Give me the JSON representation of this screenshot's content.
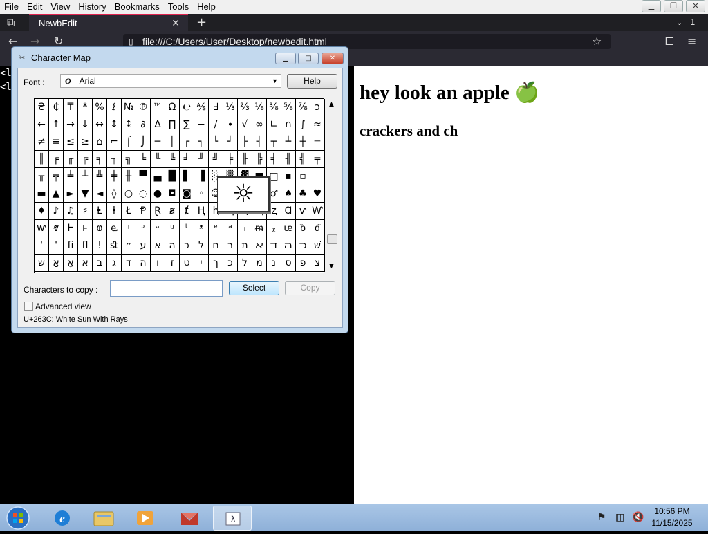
{
  "menubar": {
    "items": [
      "File",
      "Edit",
      "View",
      "History",
      "Bookmarks",
      "Tools",
      "Help"
    ],
    "window_buttons": [
      "minimize",
      "restore",
      "close"
    ]
  },
  "browser": {
    "tab_title": "NewbEdit",
    "tab_close": "✕",
    "new_tab": "+",
    "url": "file:///C:/Users/User/Desktop/newbedit.html",
    "account_badge": "1",
    "icons": [
      "tab-overview-icon",
      "back-icon",
      "forward-icon",
      "reload-icon",
      "page-icon",
      "bookmark-star-icon",
      "extensions-icon",
      "menu-icon"
    ]
  },
  "page": {
    "left_code_lines": [
      "<l",
      "<l"
    ],
    "heading": "hey look an apple 🍏",
    "subheading": "crackers and ch"
  },
  "charmap": {
    "title": "Character Map",
    "font_label": "Font :",
    "font_value": "Arial",
    "help_label": "Help",
    "grid_rows": [
      [
        "₴",
        "₵",
        "₸",
        "*",
        "%",
        "ℓ",
        "№",
        "℗",
        "™",
        "Ω",
        "℮",
        "⅍",
        "Ⅎ",
        "⅓",
        "⅔",
        "⅛",
        "⅜",
        "⅝",
        "⅞",
        "ↄ"
      ],
      [
        "←",
        "↑",
        "→",
        "↓",
        "↔",
        "↕",
        "↨",
        "∂",
        "∆",
        "∏",
        "∑",
        "−",
        "∕",
        "∙",
        "√",
        "∞",
        "∟",
        "∩",
        "∫",
        "≈"
      ],
      [
        "≠",
        "≡",
        "≤",
        "≥",
        "⌂",
        "⌐",
        "⌠",
        "⌡",
        "─",
        "│",
        "┌",
        "┐",
        "└",
        "┘",
        "├",
        "┤",
        "┬",
        "┴",
        "┼",
        "═"
      ],
      [
        "║",
        "╒",
        "╓",
        "╔",
        "╕",
        "╖",
        "╗",
        "╘",
        "╙",
        "╚",
        "╛",
        "╜",
        "╝",
        "╞",
        "╟",
        "╠",
        "╡",
        "╢",
        "╣",
        "╤"
      ],
      [
        "╥",
        "╦",
        "╧",
        "╨",
        "╩",
        "╪",
        "╫",
        "▀",
        "▄",
        "█",
        "▌",
        "▐",
        "░",
        "▒",
        "▓",
        "■",
        "□",
        "▪",
        "▫",
        ""
      ],
      [
        "▬",
        "▲",
        "►",
        "▼",
        "◄",
        "◊",
        "○",
        "◌",
        "●",
        "◘",
        "◙",
        "◦",
        "☺",
        "☻",
        "☼",
        "♀",
        "♂",
        "♠",
        "♣",
        "♥"
      ],
      [
        "♦",
        "♪",
        "♫",
        "♯",
        "Ⱡ",
        "ⱡ",
        "Ł",
        "Ᵽ",
        "Ɽ",
        "ⱥ",
        "ⱦ",
        "Ⱨ",
        "ⱨ",
        "Ⱪ",
        "ⱪ",
        "Ⱬ",
        "ⱬ",
        "Ɑ",
        "ⱱ",
        "Ⱳ"
      ],
      [
        "ⱳ",
        "ⱴ",
        "Ⱶ",
        "ⱶ",
        "ⱷ",
        "ⱸ",
        "ᵎ",
        "ᵓ",
        "ᵕ",
        "ᵑ",
        "ᵗ",
        "ᵜ",
        "ᵉ",
        "ᵃ",
        "ᵢ",
        "ᵯ",
        "ᵪ",
        "ᵫ",
        "ᵬ",
        "ᵭ"
      ],
      [
        "'",
        "'",
        "ﬁ",
        "ﬂ",
        "!",
        "ﬆ",
        "״",
        "ע",
        "א",
        "ה",
        "כ",
        "ל",
        "ם",
        "ר",
        "ת",
        "ﬡ",
        "ﬢ",
        "ﬣ",
        "ﬤ",
        "שׁ"
      ],
      [
        "שׂ",
        "אַ",
        "אָ",
        "א",
        "ב",
        "ג",
        "ד",
        "ה",
        "ו",
        "ז",
        "ט",
        "י",
        "ך",
        "כ",
        "ל",
        "מ",
        "נ",
        "ס",
        "פ",
        "צ"
      ]
    ],
    "magnified_char": "☼",
    "copy_label": "Characters to copy :",
    "copy_value": "",
    "select_label": "Select",
    "copy_button_label": "Copy",
    "advanced_view_label": "Advanced view",
    "advanced_view_checked": false,
    "status_text": "U+263C: White Sun With Rays"
  },
  "taskbar": {
    "clock_time": "10:56 PM",
    "clock_date": "11/15/2025",
    "items": [
      "start-orb",
      "internet-explorer-icon",
      "file-explorer-icon",
      "media-player-icon",
      "newbedit-app-icon",
      "character-map-icon"
    ],
    "active_item": "character-map-icon",
    "tray_icons": [
      "action-center-flag-icon",
      "network-icon",
      "volume-muted-icon"
    ]
  },
  "colors": {
    "browser_bg": "#2b2a33",
    "tab_accent": "#e0234e",
    "dialog_frame": "#c3d9ee",
    "taskbar": "#a9c6e6"
  }
}
